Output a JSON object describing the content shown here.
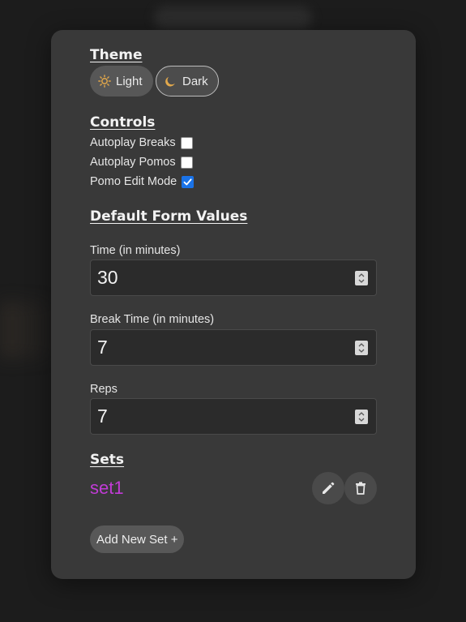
{
  "theme": {
    "heading": "Theme",
    "options": [
      {
        "label": "Light",
        "icon": "sun-icon",
        "selected": false
      },
      {
        "label": "Dark",
        "icon": "moon-icon",
        "selected": true
      }
    ]
  },
  "controls": {
    "heading": "Controls",
    "items": [
      {
        "label": "Autoplay Breaks",
        "checked": false
      },
      {
        "label": "Autoplay Pomos",
        "checked": false
      },
      {
        "label": "Pomo Edit Mode",
        "checked": true
      }
    ]
  },
  "defaults": {
    "heading": "Default Form Values",
    "fields": [
      {
        "label": "Time (in minutes)",
        "value": "30"
      },
      {
        "label": "Break Time (in minutes)",
        "value": "7"
      },
      {
        "label": "Reps",
        "value": "7"
      }
    ]
  },
  "sets": {
    "heading": "Sets",
    "items": [
      {
        "name": "set1"
      }
    ],
    "add_label": "Add New Set +"
  },
  "colors": {
    "panel": "#393939",
    "page": "#1c1c1c",
    "set_name": "#c13bd6",
    "checkbox_checked": "#1a73e8"
  }
}
